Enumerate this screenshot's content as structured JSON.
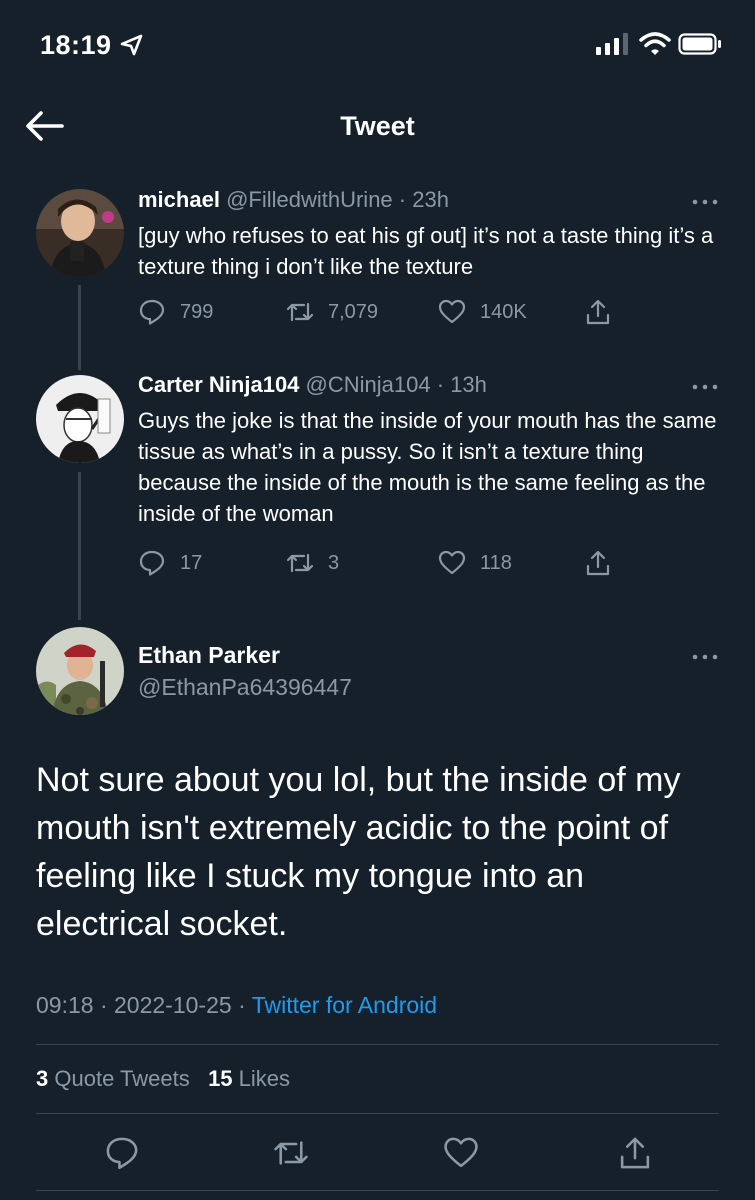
{
  "status_bar": {
    "time": "18:19"
  },
  "nav": {
    "title": "Tweet"
  },
  "thread": [
    {
      "name": "michael",
      "handle": "@FilledwithUrine",
      "time": "23h",
      "text": "[guy who refuses to eat his gf out] it’s not a taste thing it’s a texture thing i don’t like the texture",
      "replies": "799",
      "retweets": "7,079",
      "likes": "140K"
    },
    {
      "name": "Carter Ninja104",
      "handle": "@CNinja104",
      "time": "13h",
      "text": "Guys the joke is that the inside of your mouth has the same tissue as what’s in a pussy. So it isn’t a texture thing because the inside of the mouth is the same feeling as the inside of the woman",
      "replies": "17",
      "retweets": "3",
      "likes": "118"
    }
  ],
  "main_tweet": {
    "name": "Ethan Parker",
    "handle": "@EthanPa64396447",
    "text": "Not sure about you lol, but the inside of my mouth isn't extremely acidic to the point of feeling like I stuck my tongue into an electrical socket.",
    "time": "09:18",
    "date": "2022-10-25",
    "source": "Twitter for Android",
    "quote_count": "3",
    "quote_label": "Quote Tweets",
    "like_count": "15",
    "like_label": "Likes"
  },
  "separator": "·",
  "colors": {
    "background": "#15202b",
    "muted": "#8b98a5",
    "accent": "#1d9bf0",
    "divider": "#38444d"
  },
  "icons": [
    "location-arrow-icon",
    "signal-icon",
    "wifi-icon",
    "battery-icon",
    "back-arrow-icon",
    "more-icon",
    "reply-icon",
    "retweet-icon",
    "like-icon",
    "share-icon"
  ]
}
